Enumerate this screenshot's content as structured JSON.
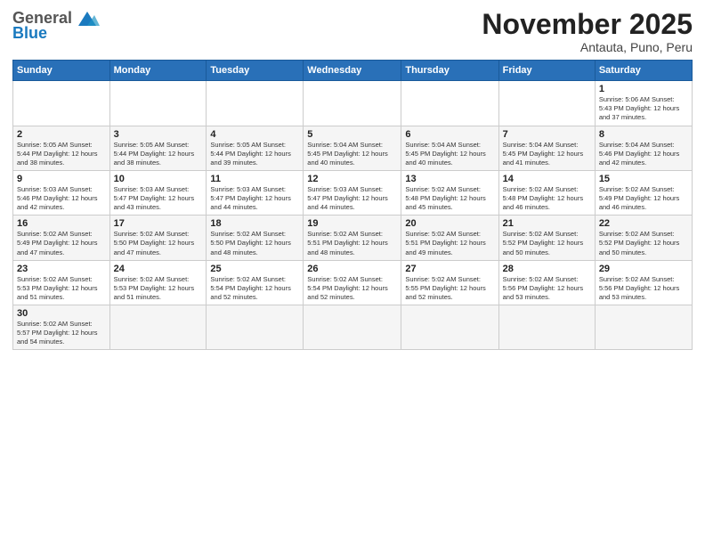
{
  "logo": {
    "general": "General",
    "blue": "Blue"
  },
  "header": {
    "month": "November 2025",
    "location": "Antauta, Puno, Peru"
  },
  "weekdays": [
    "Sunday",
    "Monday",
    "Tuesday",
    "Wednesday",
    "Thursday",
    "Friday",
    "Saturday"
  ],
  "weeks": [
    [
      {
        "day": "",
        "content": ""
      },
      {
        "day": "",
        "content": ""
      },
      {
        "day": "",
        "content": ""
      },
      {
        "day": "",
        "content": ""
      },
      {
        "day": "",
        "content": ""
      },
      {
        "day": "",
        "content": ""
      },
      {
        "day": "1",
        "content": "Sunrise: 5:06 AM\nSunset: 5:43 PM\nDaylight: 12 hours\nand 37 minutes."
      }
    ],
    [
      {
        "day": "2",
        "content": "Sunrise: 5:05 AM\nSunset: 5:44 PM\nDaylight: 12 hours\nand 38 minutes."
      },
      {
        "day": "3",
        "content": "Sunrise: 5:05 AM\nSunset: 5:44 PM\nDaylight: 12 hours\nand 38 minutes."
      },
      {
        "day": "4",
        "content": "Sunrise: 5:05 AM\nSunset: 5:44 PM\nDaylight: 12 hours\nand 39 minutes."
      },
      {
        "day": "5",
        "content": "Sunrise: 5:04 AM\nSunset: 5:45 PM\nDaylight: 12 hours\nand 40 minutes."
      },
      {
        "day": "6",
        "content": "Sunrise: 5:04 AM\nSunset: 5:45 PM\nDaylight: 12 hours\nand 40 minutes."
      },
      {
        "day": "7",
        "content": "Sunrise: 5:04 AM\nSunset: 5:45 PM\nDaylight: 12 hours\nand 41 minutes."
      },
      {
        "day": "8",
        "content": "Sunrise: 5:04 AM\nSunset: 5:46 PM\nDaylight: 12 hours\nand 42 minutes."
      }
    ],
    [
      {
        "day": "9",
        "content": "Sunrise: 5:03 AM\nSunset: 5:46 PM\nDaylight: 12 hours\nand 42 minutes."
      },
      {
        "day": "10",
        "content": "Sunrise: 5:03 AM\nSunset: 5:47 PM\nDaylight: 12 hours\nand 43 minutes."
      },
      {
        "day": "11",
        "content": "Sunrise: 5:03 AM\nSunset: 5:47 PM\nDaylight: 12 hours\nand 44 minutes."
      },
      {
        "day": "12",
        "content": "Sunrise: 5:03 AM\nSunset: 5:47 PM\nDaylight: 12 hours\nand 44 minutes."
      },
      {
        "day": "13",
        "content": "Sunrise: 5:02 AM\nSunset: 5:48 PM\nDaylight: 12 hours\nand 45 minutes."
      },
      {
        "day": "14",
        "content": "Sunrise: 5:02 AM\nSunset: 5:48 PM\nDaylight: 12 hours\nand 46 minutes."
      },
      {
        "day": "15",
        "content": "Sunrise: 5:02 AM\nSunset: 5:49 PM\nDaylight: 12 hours\nand 46 minutes."
      }
    ],
    [
      {
        "day": "16",
        "content": "Sunrise: 5:02 AM\nSunset: 5:49 PM\nDaylight: 12 hours\nand 47 minutes."
      },
      {
        "day": "17",
        "content": "Sunrise: 5:02 AM\nSunset: 5:50 PM\nDaylight: 12 hours\nand 47 minutes."
      },
      {
        "day": "18",
        "content": "Sunrise: 5:02 AM\nSunset: 5:50 PM\nDaylight: 12 hours\nand 48 minutes."
      },
      {
        "day": "19",
        "content": "Sunrise: 5:02 AM\nSunset: 5:51 PM\nDaylight: 12 hours\nand 48 minutes."
      },
      {
        "day": "20",
        "content": "Sunrise: 5:02 AM\nSunset: 5:51 PM\nDaylight: 12 hours\nand 49 minutes."
      },
      {
        "day": "21",
        "content": "Sunrise: 5:02 AM\nSunset: 5:52 PM\nDaylight: 12 hours\nand 50 minutes."
      },
      {
        "day": "22",
        "content": "Sunrise: 5:02 AM\nSunset: 5:52 PM\nDaylight: 12 hours\nand 50 minutes."
      }
    ],
    [
      {
        "day": "23",
        "content": "Sunrise: 5:02 AM\nSunset: 5:53 PM\nDaylight: 12 hours\nand 51 minutes."
      },
      {
        "day": "24",
        "content": "Sunrise: 5:02 AM\nSunset: 5:53 PM\nDaylight: 12 hours\nand 51 minutes."
      },
      {
        "day": "25",
        "content": "Sunrise: 5:02 AM\nSunset: 5:54 PM\nDaylight: 12 hours\nand 52 minutes."
      },
      {
        "day": "26",
        "content": "Sunrise: 5:02 AM\nSunset: 5:54 PM\nDaylight: 12 hours\nand 52 minutes."
      },
      {
        "day": "27",
        "content": "Sunrise: 5:02 AM\nSunset: 5:55 PM\nDaylight: 12 hours\nand 52 minutes."
      },
      {
        "day": "28",
        "content": "Sunrise: 5:02 AM\nSunset: 5:56 PM\nDaylight: 12 hours\nand 53 minutes."
      },
      {
        "day": "29",
        "content": "Sunrise: 5:02 AM\nSunset: 5:56 PM\nDaylight: 12 hours\nand 53 minutes."
      }
    ],
    [
      {
        "day": "30",
        "content": "Sunrise: 5:02 AM\nSunset: 5:57 PM\nDaylight: 12 hours\nand 54 minutes."
      },
      {
        "day": "",
        "content": ""
      },
      {
        "day": "",
        "content": ""
      },
      {
        "day": "",
        "content": ""
      },
      {
        "day": "",
        "content": ""
      },
      {
        "day": "",
        "content": ""
      },
      {
        "day": "",
        "content": ""
      }
    ]
  ]
}
